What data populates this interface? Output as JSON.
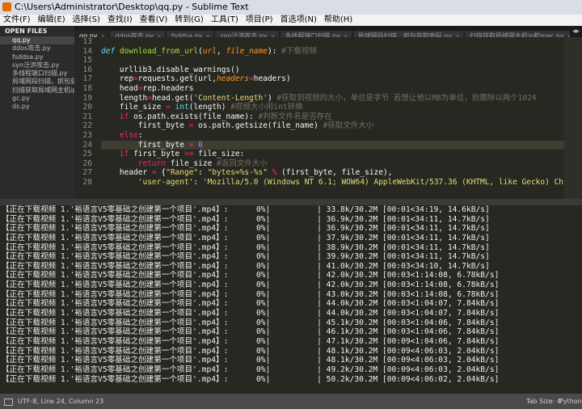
{
  "window": {
    "title": "C:\\Users\\Administrator\\Desktop\\qq.py - Sublime Text"
  },
  "menu": [
    "文件(F)",
    "编辑(E)",
    "选择(S)",
    "查找(I)",
    "查看(V)",
    "转到(G)",
    "工具(T)",
    "项目(P)",
    "首选项(N)",
    "帮助(H)"
  ],
  "sidebar": {
    "header": "OPEN FILES",
    "items": [
      "qq.py",
      "ddos攻击.py",
      "fsddsa.py",
      "syn泛洪攻击.py",
      "多线程端口扫描.py",
      "局域网段扫描，抓包获取",
      "扫描获取局域网主机ip和",
      "gc.py",
      "ds.py"
    ],
    "selected_index": 0
  },
  "tabs": [
    {
      "label": "qq.py",
      "active": true
    },
    {
      "label": "ddos攻击.py",
      "active": false
    },
    {
      "label": "fsddsa.py",
      "active": false
    },
    {
      "label": "syn泛洪攻击.py",
      "active": false
    },
    {
      "label": "多线程端口扫描.py",
      "active": false
    },
    {
      "label": "局域网段扫描，抓包获取密码.py",
      "active": false
    },
    {
      "label": "扫描获取局域网主机ip和mac.py",
      "active": false
    },
    {
      "label": "gc.py",
      "active": false
    }
  ],
  "tab_nav": "◂▸",
  "editor": {
    "current_line": 24,
    "lines": [
      {
        "n": "13",
        "t": [
          [
            "",
            ""
          ]
        ]
      },
      {
        "n": "14",
        "t": [
          [
            "d",
            "def "
          ],
          [
            "fn",
            "download_from_url"
          ],
          [
            "",
            "("
          ],
          [
            "p",
            "url"
          ],
          [
            "",
            ", "
          ],
          [
            "p",
            "file_name"
          ],
          [
            "",
            "): "
          ],
          [
            "c",
            "#下载视频"
          ]
        ]
      },
      {
        "n": "15",
        "t": [
          [
            "",
            ""
          ]
        ]
      },
      {
        "n": "16",
        "t": [
          [
            "",
            "    urllib3.disable_warnings()"
          ]
        ]
      },
      {
        "n": "17",
        "t": [
          [
            "",
            "    rep"
          ],
          [
            "k",
            "="
          ],
          [
            "",
            "requests.get(url,"
          ],
          [
            "p",
            "headers"
          ],
          [
            "k",
            "="
          ],
          [
            "",
            "headers)"
          ]
        ]
      },
      {
        "n": "18",
        "t": [
          [
            "",
            "    head"
          ],
          [
            "k",
            "="
          ],
          [
            "",
            "rep.headers"
          ]
        ]
      },
      {
        "n": "19",
        "t": [
          [
            "",
            "    length"
          ],
          [
            "k",
            "="
          ],
          [
            "",
            "head.get("
          ],
          [
            "s",
            "'Content-Length'"
          ],
          [
            "",
            ") "
          ],
          [
            "c",
            "#获取到视频的大小，单位是字节 若想让他以MB为单位，则需除以两个1024"
          ]
        ]
      },
      {
        "n": "20",
        "t": [
          [
            "",
            "    file_size "
          ],
          [
            "k",
            "="
          ],
          [
            "",
            " "
          ],
          [
            "b",
            "int"
          ],
          [
            "",
            "(length) "
          ],
          [
            "c",
            "#视频大小用int转换"
          ]
        ]
      },
      {
        "n": "21",
        "t": [
          [
            "",
            "    "
          ],
          [
            "k",
            "if"
          ],
          [
            "",
            " os.path.exists(file_name): "
          ],
          [
            "c",
            "#判断文件名是否存在"
          ]
        ]
      },
      {
        "n": "22",
        "t": [
          [
            "",
            "        first_byte "
          ],
          [
            "k",
            "="
          ],
          [
            "",
            " os.path.getsize(file_name) "
          ],
          [
            "c",
            "#获取文件大小"
          ]
        ]
      },
      {
        "n": "23",
        "t": [
          [
            "",
            "    "
          ],
          [
            "k",
            "else"
          ],
          [
            "",
            ":"
          ]
        ]
      },
      {
        "n": "24",
        "t": [
          [
            "",
            "        first_byte "
          ],
          [
            "k",
            "="
          ],
          [
            "",
            " "
          ],
          [
            "n",
            "0"
          ]
        ]
      },
      {
        "n": "25",
        "t": [
          [
            "",
            "    "
          ],
          [
            "k",
            "if"
          ],
          [
            "",
            " first_byte "
          ],
          [
            "k",
            ">="
          ],
          [
            "",
            " file_size:"
          ]
        ]
      },
      {
        "n": "26",
        "t": [
          [
            "",
            "        "
          ],
          [
            "k",
            "return"
          ],
          [
            "",
            " file_size "
          ],
          [
            "c",
            "#返回文件大小"
          ]
        ]
      },
      {
        "n": "27",
        "t": [
          [
            "",
            "    header "
          ],
          [
            "k",
            "="
          ],
          [
            "",
            " {"
          ],
          [
            "s",
            "\"Range\""
          ],
          [
            "",
            ": "
          ],
          [
            "s",
            "\"bytes=%s-%s\""
          ],
          [
            "",
            " "
          ],
          [
            "k",
            "%"
          ],
          [
            "",
            " (first_byte, file_size),"
          ]
        ]
      },
      {
        "n": "28",
        "t": [
          [
            "",
            "        "
          ],
          [
            "s",
            "'user-agent'"
          ],
          [
            "",
            ": "
          ],
          [
            "s",
            "'Mozilla/5.0 (Windows NT 6.1; WOW64) AppleWebKit/537.36 (KHTML, like Gecko) Chrome"
          ]
        ]
      }
    ]
  },
  "console": {
    "lines": [
      "【正在下载视频 1.'裕语言V5零基础之创建第一个项目'.mp4】:      0%|          | 33.8k/30.2M [00:01<34:19, 14.6kB/s]",
      "【正在下载视频 1.'裕语言V5零基础之创建第一个项目'.mp4】:      0%|          | 36.9k/30.2M [00:01<34:11, 14.7kB/s]",
      "【正在下载视频 1.'裕语言V5零基础之创建第一个项目'.mp4】:      0%|          | 36.9k/30.2M [00:01<34:11, 14.7kB/s]",
      "【正在下载视频 1.'裕语言V5零基础之创建第一个项目'.mp4】:      0%|          | 37.9k/30.2M [00:01<34:11, 14.7kB/s]",
      "【正在下载视频 1.'裕语言V5零基础之创建第一个项目'.mp4】:      0%|          | 38.9k/30.2M [00:01<34:11, 14.7kB/s]",
      "【正在下载视频 1.'裕语言V5零基础之创建第一个项目'.mp4】:      0%|          | 39.9k/30.2M [00:01<34:11, 14.7kB/s]",
      "【正在下载视频 1.'裕语言V5零基础之创建第一个项目'.mp4】:      0%|          | 41.0k/30.2M [00:03<34:10, 14.7kB/s]",
      "【正在下载视频 1.'裕语言V5零基础之创建第一个项目'.mp4】:      0%|          | 42.0k/30.2M [00:03<1:14:08, 6.78kB/s]",
      "【正在下载视频 1.'裕语言V5零基础之创建第一个项目'.mp4】:      0%|          | 42.0k/30.2M [00:03<1:14:08, 6.78kB/s]",
      "【正在下载视频 1.'裕语言V5零基础之创建第一个项目'.mp4】:      0%|          | 43.0k/30.2M [00:03<1:14:08, 6.78kB/s]",
      "【正在下载视频 1.'裕语言V5零基础之创建第一个项目'.mp4】:      0%|          | 44.0k/30.2M [00:03<1:04:07, 7.84kB/s]",
      "【正在下载视频 1.'裕语言V5零基础之创建第一个项目'.mp4】:      0%|          | 44.0k/30.2M [00:03<1:04:07, 7.84kB/s]",
      "【正在下载视频 1.'裕语言V5零基础之创建第一个项目'.mp4】:      0%|          | 45.1k/30.2M [00:03<1:04:06, 7.84kB/s]",
      "【正在下载视频 1.'裕语言V5零基础之创建第一个项目'.mp4】:      0%|          | 46.1k/30.2M [00:03<1:04:06, 7.84kB/s]",
      "【正在下载视频 1.'裕语言V5零基础之创建第一个项目'.mp4】:      0%|          | 47.1k/30.2M [00:09<1:04:06, 7.84kB/s]",
      "【正在下载视频 1.'裕语言V5零基础之创建第一个项目'.mp4】:      0%|          | 48.1k/30.2M [00:09<4:06:03, 2.04kB/s]",
      "【正在下载视频 1.'裕语言V5零基础之创建第一个项目'.mp4】:      0%|          | 48.1k/30.2M [00:09<4:06:03, 2.04kB/s]",
      "【正在下载视频 1.'裕语言V5零基础之创建第一个项目'.mp4】:      0%|          | 49.2k/30.2M [00:09<4:06:03, 2.04kB/s]",
      "【正在下载视频 1.'裕语言V5零基础之创建第一个项目'.mp4】:      0%|          | 50.2k/30.2M [00:09<4:06:02, 2.04kB/s]"
    ]
  },
  "status": {
    "text": "UTF-8, Line 24, Column 23",
    "tab_size": "Tab Size: 4",
    "syntax": "Python"
  },
  "colors": {
    "editor_bg": "#272822",
    "keyword": "#f92672",
    "function": "#a6e22e",
    "string": "#e6db74",
    "comment": "#75715e",
    "param": "#fd971f"
  }
}
